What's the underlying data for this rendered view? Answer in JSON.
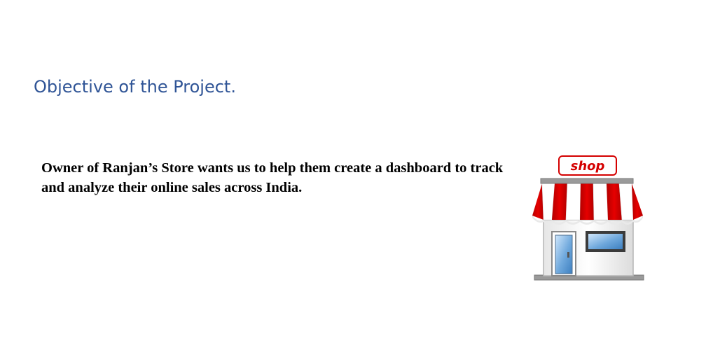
{
  "slide": {
    "title": "Objective of the Project.",
    "body": "Owner of Ranjan’s Store wants us to help them create a dashboard to track and analyze their online sales across India."
  },
  "illustration": {
    "icon": "shop-storefront-icon",
    "sign_text": "shop",
    "colors": {
      "awning_red": "#d40000",
      "awning_white": "#ffffff",
      "sign_text": "#d40000",
      "glass_blue": "#6fa8dc",
      "frame_gray": "#8a8a8a"
    }
  }
}
